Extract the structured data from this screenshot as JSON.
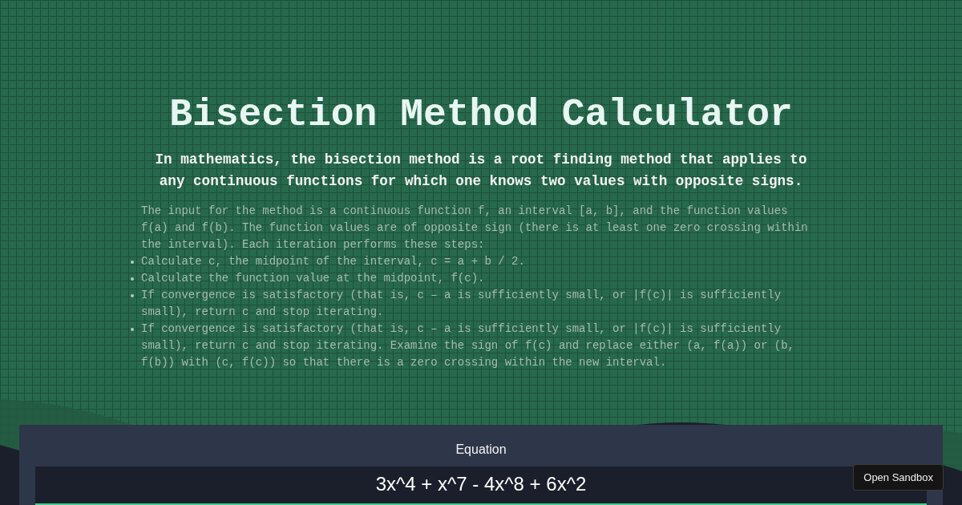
{
  "title": "Bisection Method Calculator",
  "subtitle": "In mathematics, the bisection method is a root finding method that applies to any continuous functions for which one knows two values with opposite signs.",
  "description": {
    "intro": "The input for the method is a continuous function f, an interval [a, b], and the function values f(a) and f(b). The function values are of opposite sign (there is at least one zero crossing within the interval). Each iteration performs these steps:",
    "steps": [
      "Calculate c, the midpoint of the interval, c = a + b / 2.",
      "Calculate the function value at the midpoint, f(c).",
      "If convergence is satisfactory (that is, c – a is sufficiently small, or |f(c)| is sufficiently small), return c and stop iterating.",
      "If convergence is satisfactory (that is, c – a is sufficiently small, or |f(c)| is sufficiently small), return c and stop iterating. Examine the sign of f(c) and replace either (a, f(a)) or (b, f(b)) with (c, f(c)) so that there is a zero crossing within the new interval."
    ]
  },
  "equation": {
    "label": "Equation",
    "value": "3x^4 + x^7 - 4x^8 + 6x^2"
  },
  "sandbox_button": "Open Sandbox"
}
